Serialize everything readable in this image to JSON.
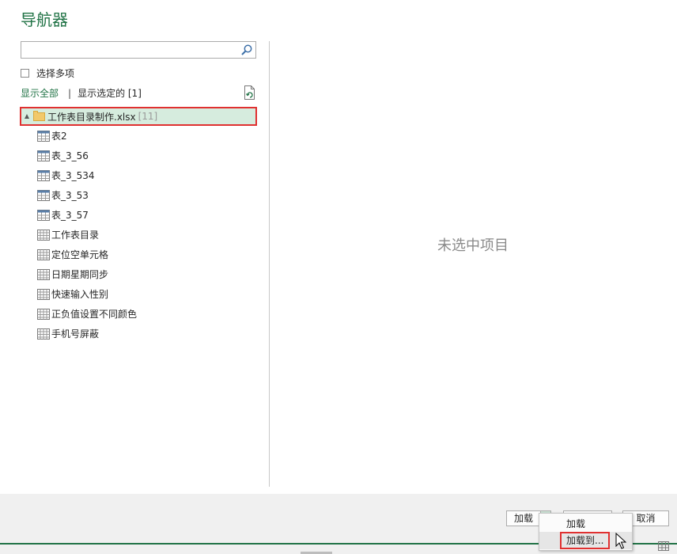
{
  "dialog": {
    "title": "导航器"
  },
  "search": {
    "value": "",
    "placeholder": "",
    "icon": "search-icon"
  },
  "options": {
    "select_multiple": "选择多项",
    "show_all": "显示全部",
    "separator": "|",
    "show_selected": "显示选定的 [1]"
  },
  "tree": {
    "root": {
      "name": "工作表目录制作.xlsx",
      "count": "[11]"
    },
    "tables": [
      {
        "label": "表2"
      },
      {
        "label": "表_3_56"
      },
      {
        "label": "表_3_534"
      },
      {
        "label": "表_3_53"
      },
      {
        "label": "表_3_57"
      }
    ],
    "sheets": [
      {
        "label": "工作表目录"
      },
      {
        "label": "定位空单元格"
      },
      {
        "label": "日期星期同步"
      },
      {
        "label": "快速输入性别"
      },
      {
        "label": "正负值设置不同颜色"
      },
      {
        "label": "手机号屏蔽"
      }
    ]
  },
  "preview": {
    "empty_message": "未选中项目"
  },
  "footer": {
    "load_button": "加载",
    "cancel_button": "取消",
    "dropdown": {
      "load": "加载",
      "load_to": "加载到..."
    }
  },
  "colors": {
    "accent": "#217346",
    "highlight": "#e03030",
    "selected_bg": "#d6ecde"
  }
}
